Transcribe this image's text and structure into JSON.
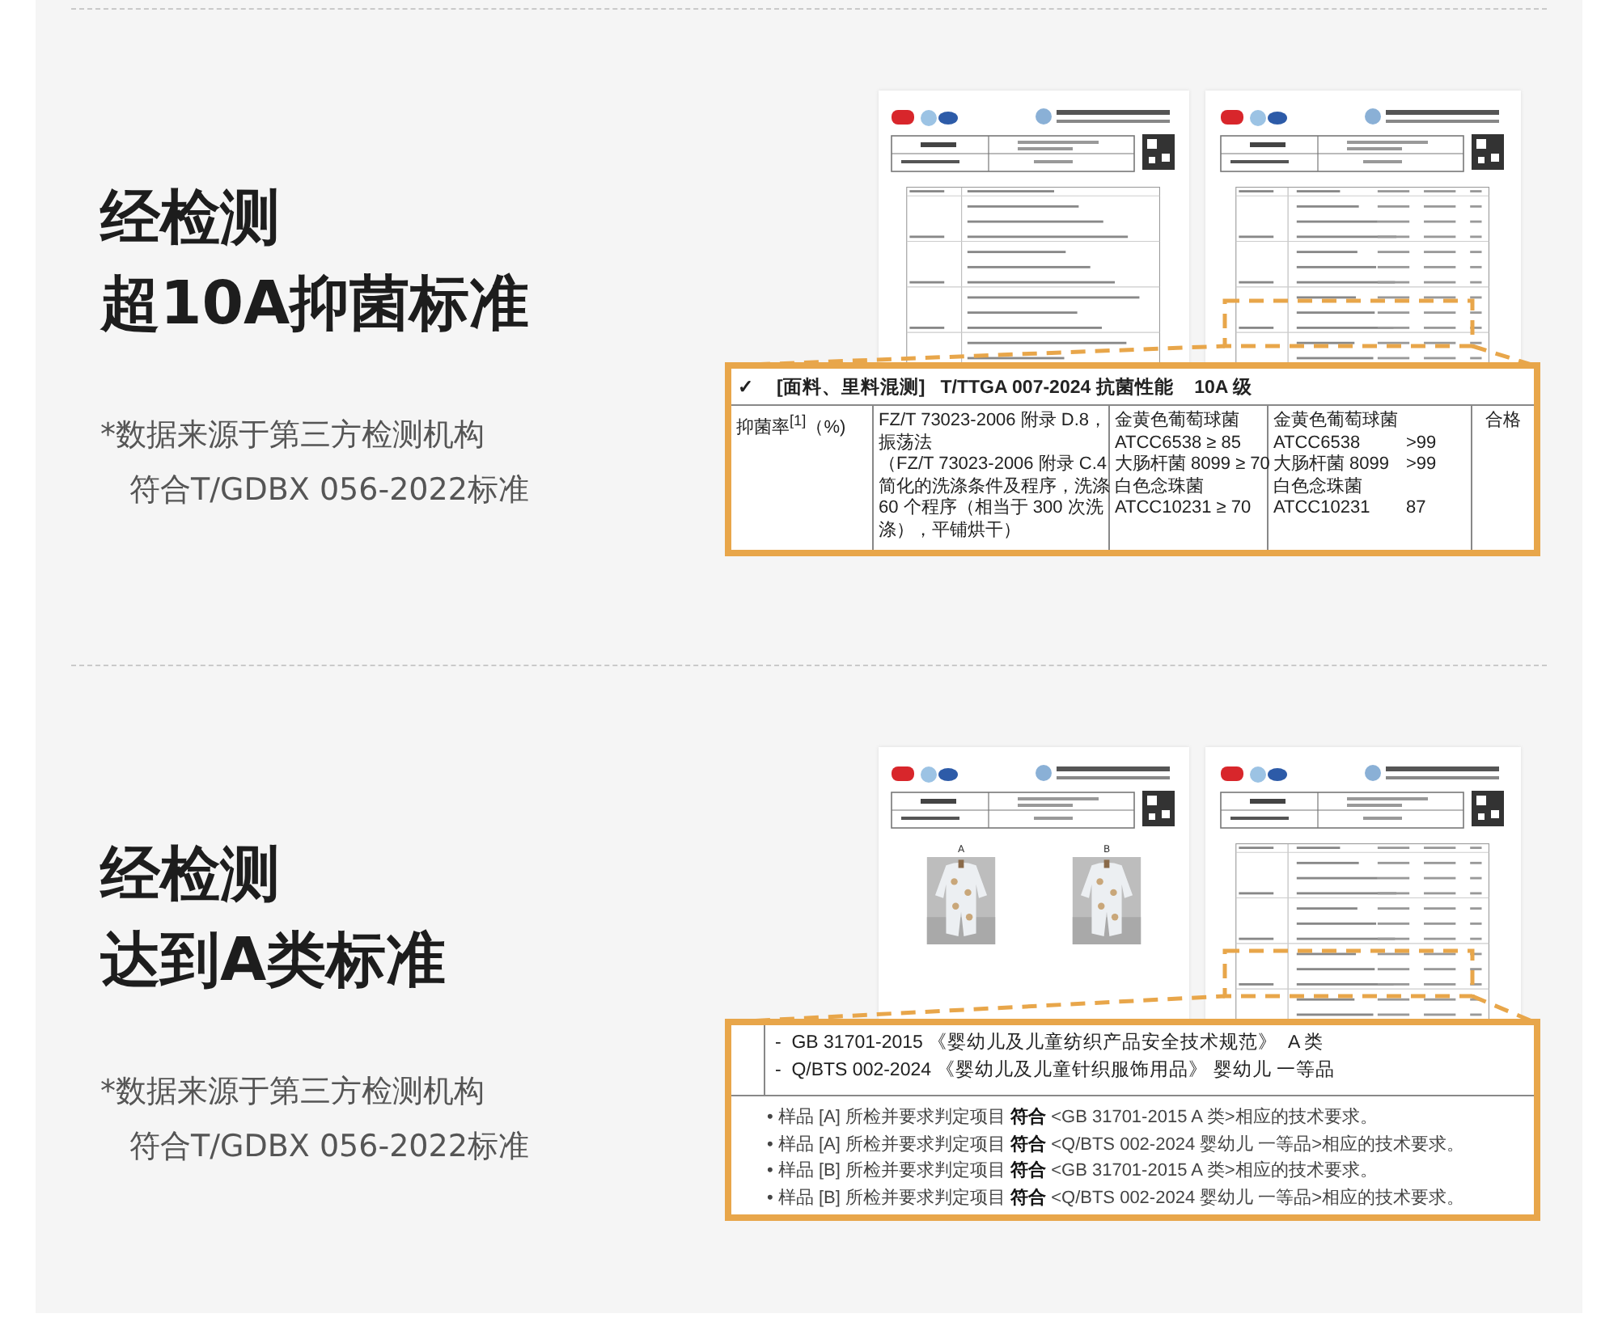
{
  "sections": [
    {
      "heading": [
        "经检测",
        "超10A抑菌标准"
      ],
      "notes": [
        "*数据来源于第三方检测机构",
        "符合T/GDBX 056-2022标准"
      ],
      "pages": [
        {
          "kind": "table"
        },
        {
          "kind": "results"
        }
      ],
      "callout": {
        "kind": "table",
        "header": {
          "mark": "✓",
          "text": "[面料、里料混测]   T/TTGA 007-2024 抗菌性能    10A 级"
        },
        "row": {
          "item": "抑菌率$^{[1]}$（%)",
          "method": [
            "FZ/T 73023-2006 附录 D.8，",
            "振荡法",
            "（FZ/T 73023-2006 附录 C.4",
            "简化的洗涤条件及程序，洗涤",
            "60 个程序（相当于 300 次洗",
            "涤），平铺烘干）"
          ],
          "requirement": [
            "金黄色葡萄球菌",
            "ATCC6538 ≥ 85",
            "大肠杆菌 8099 ≥ 70",
            "白色念珠菌",
            "ATCC10231 ≥ 70"
          ],
          "result": [
            {
              "name": "金黄色葡萄球菌"
            },
            {
              "name": "ATCC6538",
              "value": ">99"
            },
            {
              "name": "大肠杆菌 8099",
              "value": ">99"
            },
            {
              "name": "白色念珠菌"
            },
            {
              "name": "ATCC10231",
              "value": "87"
            }
          ],
          "verdict": "合格"
        }
      }
    },
    {
      "heading": [
        "经检测",
        "达到A类标准"
      ],
      "notes": [
        "*数据来源于第三方检测机构",
        "符合T/GDBX 056-2022标准"
      ],
      "pages": [
        {
          "kind": "photos",
          "photos": [
            {
              "label": "A",
              "kind": "picture"
            },
            {
              "label": "B",
              "kind": "picture"
            }
          ]
        },
        {
          "kind": "results"
        }
      ],
      "callout": {
        "kind": "list",
        "standards": [
          "-  GB 31701-2015 《婴幼儿及儿童纺织产品安全技术规范》  A 类",
          "-  Q/BTS 002-2024 《婴幼儿及儿童针织服饰用品》 婴幼儿 一等品"
        ],
        "conclusions": [
          "• 样品 [A] 所检并要求判定项目 **符合** <GB 31701-2015 A 类>相应的技术要求。",
          "• 样品 [A] 所检并要求判定项目 **符合** <Q/BTS 002-2024 婴幼儿 一等品>相应的技术要求。",
          "• 样品 [B] 所检并要求判定项目 **符合** <GB 31701-2015 A 类>相应的技术要求。",
          "• 样品 [B] 所检并要求判定项目 **符合** <Q/BTS 002-2024 婴幼儿 一等品>相应的技术要求。"
        ]
      }
    }
  ]
}
